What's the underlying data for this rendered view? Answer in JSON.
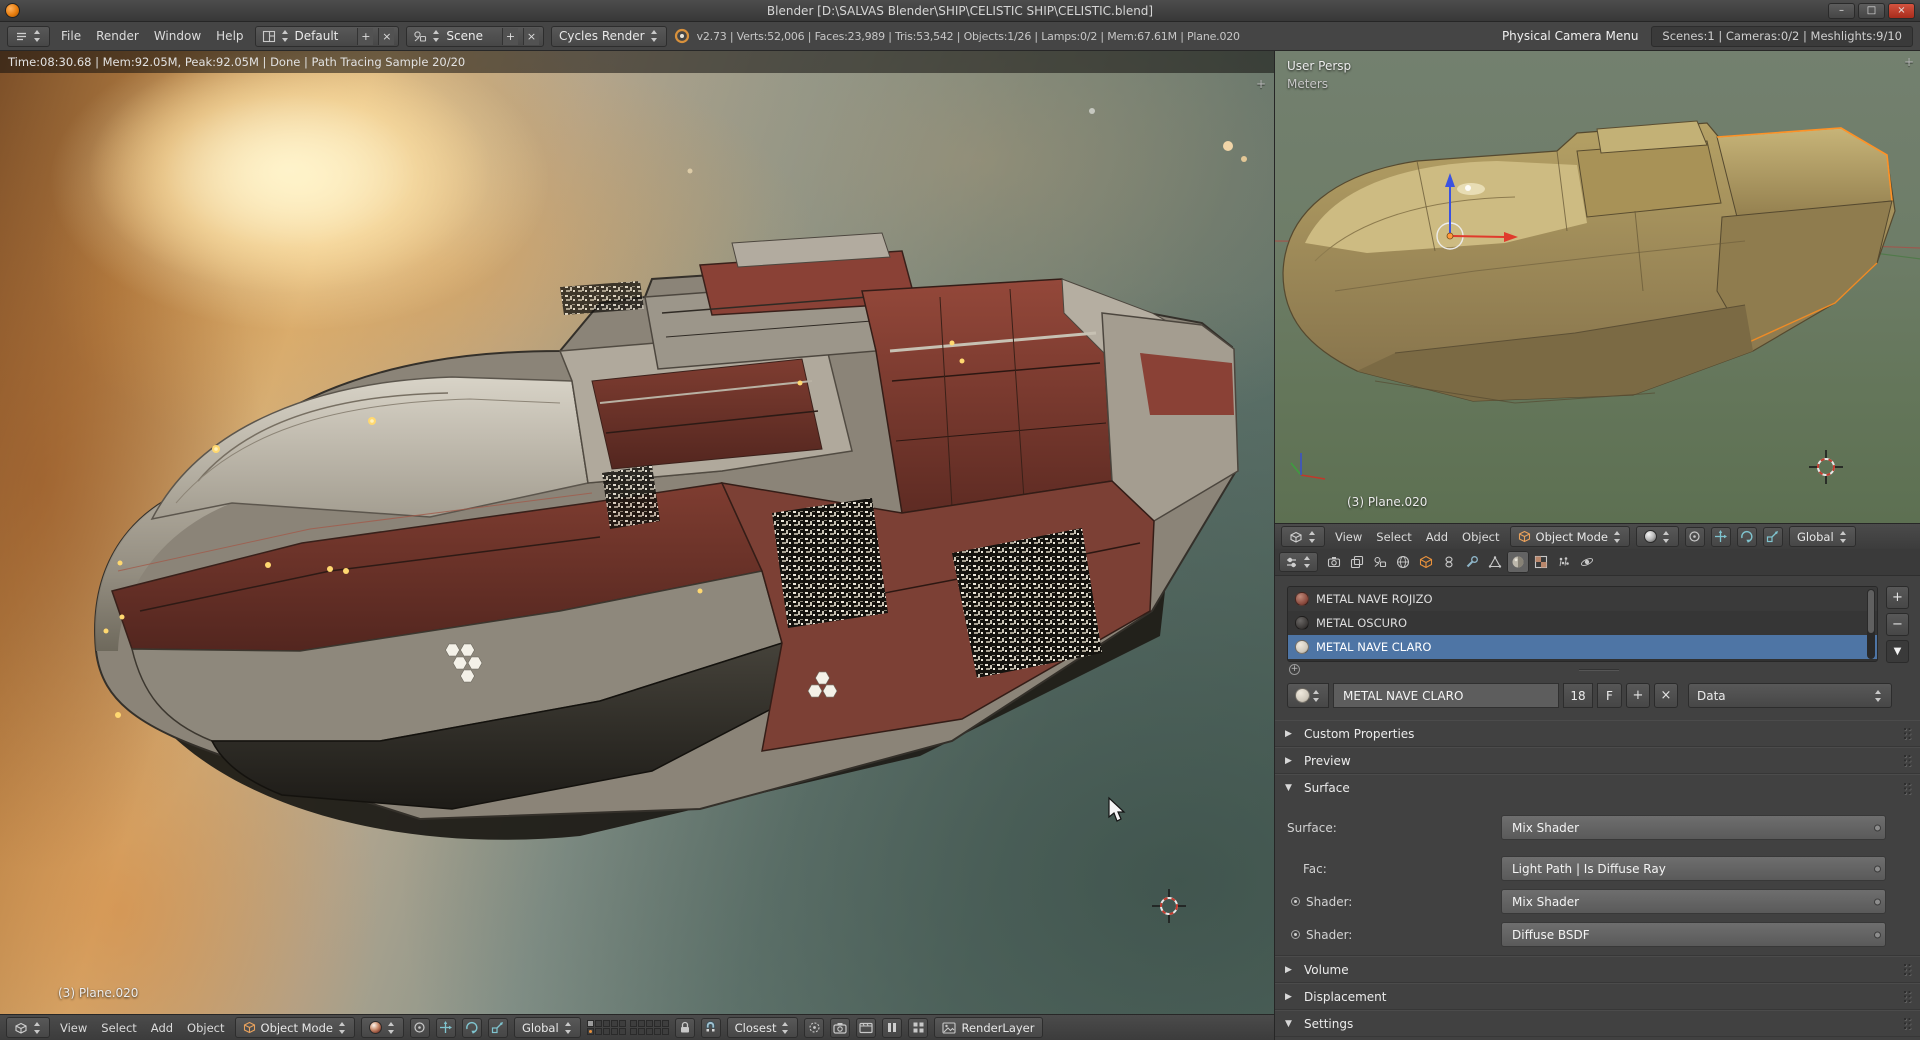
{
  "window": {
    "title": "Blender [D:\\SALVAS Blender\\SHIP\\CELISTIC SHIP\\CELISTIC.blend]",
    "controls": {
      "minimize": "–",
      "maximize": "□",
      "close": "×"
    }
  },
  "header": {
    "menus": [
      "File",
      "Render",
      "Window",
      "Help"
    ],
    "layout": "Default",
    "scene": "Scene",
    "engine": "Cycles Render",
    "stats": "v2.73 | Verts:52,006 | Faces:23,989 | Tris:53,542 | Objects:1/26 | Lamps:0/2 | Mem:67.61M | Plane.020",
    "camera_menu": "Physical Camera Menu",
    "scene_info": "Scenes:1 | Cameras:0/2 | Meshlights:9/10"
  },
  "render_view": {
    "status": "Time:08:30.68 | Mem:92.05M, Peak:92.05M | Done | Path Tracing Sample 20/20",
    "object_label": "(3) Plane.020"
  },
  "footer": {
    "menus": [
      "View",
      "Select",
      "Add",
      "Object"
    ],
    "mode": "Object Mode",
    "orientation": "Global",
    "snap_mode": "Closest",
    "render_layer": "RenderLayer"
  },
  "viewport": {
    "view_label": "User Persp",
    "units_label": "Meters",
    "object_label": "(3) Plane.020",
    "menus": [
      "View",
      "Select",
      "Add",
      "Object"
    ],
    "mode": "Object Mode",
    "orientation": "Global"
  },
  "properties": {
    "materials": [
      {
        "name": "METAL NAVE  ROJIZO",
        "color": "#8a4a3e",
        "swatch_style": "background: radial-gradient(circle at 35% 30%, #c08a7a, #8a4a3e 65%, #54271f)"
      },
      {
        "name": "METAL OSCURO",
        "color": "#3d3a38",
        "swatch_style": "background: radial-gradient(circle at 35% 30%, #6b6866, #3d3a38 65%, #1f1d1c)"
      },
      {
        "name": "METAL NAVE CLARO",
        "color": "#cfc8bb",
        "swatch_style": "background: radial-gradient(circle at 35% 30%, #efe9dd, #cfc8bb 65%, #8f887b)"
      }
    ],
    "selected_material": "METAL NAVE CLARO",
    "name_field": "METAL NAVE CLARO",
    "users_count": "18",
    "fake_user_label": "F",
    "source_label": "Data",
    "panels": {
      "custom_properties": "Custom Properties",
      "preview": "Preview",
      "surface": "Surface",
      "volume": "Volume",
      "displacement": "Displacement",
      "settings": "Settings"
    },
    "surface": {
      "surface_label": "Surface:",
      "surface_value": "Mix Shader",
      "fac_label": "Fac:",
      "fac_value": "Light Path | Is Diffuse Ray",
      "shader1_label": "Shader:",
      "shader1_value": "Mix Shader",
      "shader2_label": "Shader:",
      "shader2_value": "Diffuse BSDF"
    }
  },
  "icons": {
    "plus": "+",
    "minus": "−",
    "close_x": "×",
    "collapsed_arrow": "▶",
    "expanded_arrow": "▼",
    "filter": "▼",
    "expand_circle": "+",
    "region_corner": "+"
  },
  "colors": {
    "selection_blue": "#4e75a5",
    "selection_outline_orange": "#ff9226",
    "axis_red": "#c84b3b",
    "axis_green": "#57a557",
    "axis_blue": "#3b52d6",
    "light_dots_yellow": "#ffd870"
  }
}
